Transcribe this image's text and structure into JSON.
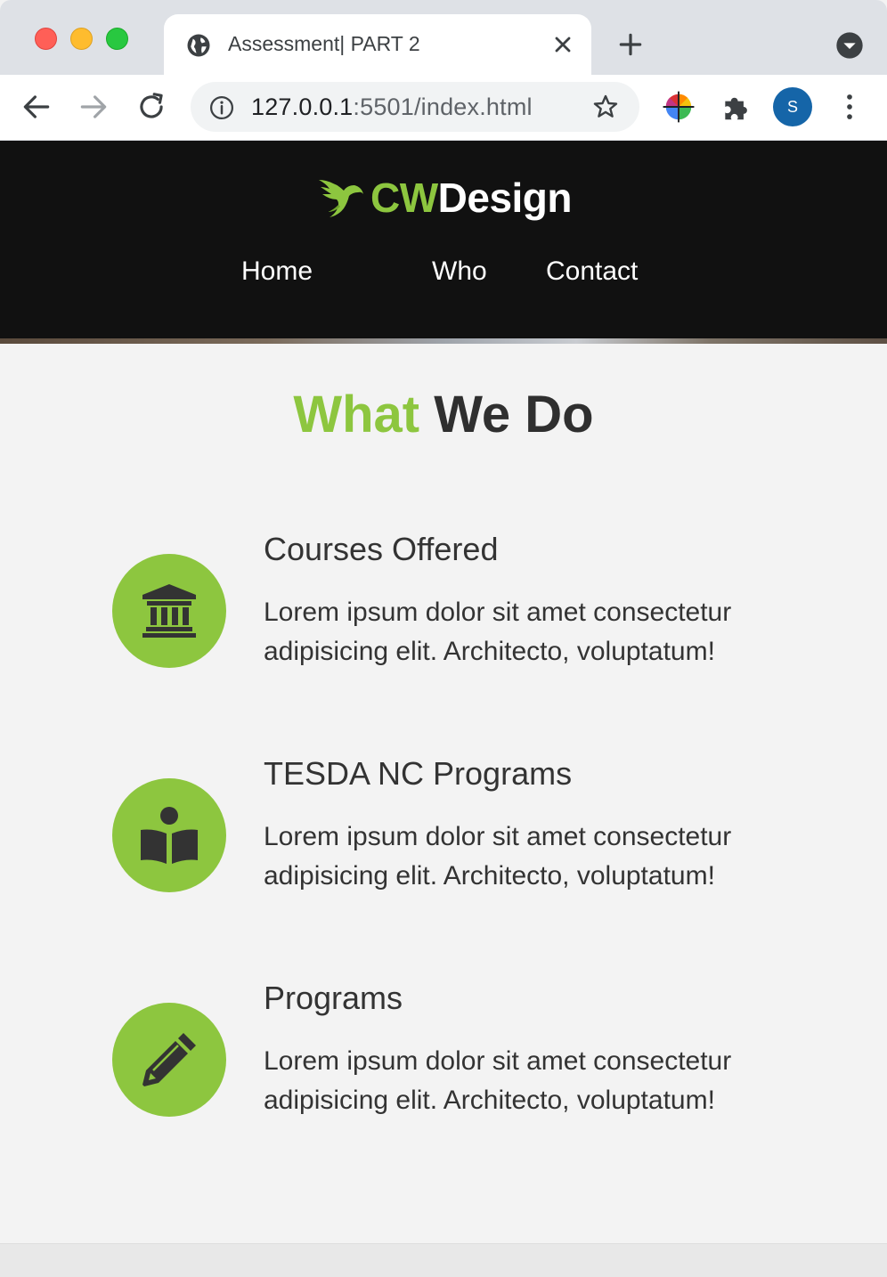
{
  "browser": {
    "tab_title": "Assessment| PART 2",
    "url_host": "127.0.0.1",
    "url_rest": ":5501/index.html",
    "profile_initial": "S"
  },
  "header": {
    "logo_accent": "CW",
    "logo_rest": "Design",
    "nav": [
      "Home",
      "Who",
      "Contact"
    ]
  },
  "section": {
    "title_accent": "What",
    "title_rest": "We Do"
  },
  "services": [
    {
      "title": "Courses Offered",
      "description": "Lorem ipsum dolor sit amet consectetur adipisicing elit. Architecto, voluptatum!",
      "icon": "university-icon"
    },
    {
      "title": "TESDA NC Programs",
      "description": "Lorem ipsum dolor sit amet consectetur adipisicing elit. Architecto, voluptatum!",
      "icon": "book-reader-icon"
    },
    {
      "title": "Programs",
      "description": "Lorem ipsum dolor sit amet consectetur adipisicing elit. Architecto, voluptatum!",
      "icon": "pencil-icon"
    }
  ],
  "colors": {
    "accent": "#8dc63f",
    "header_bg": "#111111",
    "page_bg": "#f3f3f3"
  }
}
